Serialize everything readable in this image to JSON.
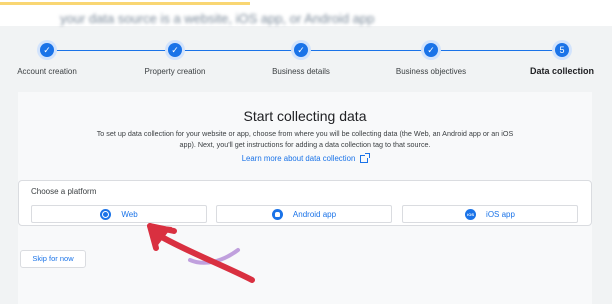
{
  "top_banner": {
    "blurred_text": "your data source is a website, iOS app, or Android app"
  },
  "stepper": {
    "steps": [
      {
        "label": "Account creation",
        "state": "done"
      },
      {
        "label": "Property creation",
        "state": "done"
      },
      {
        "label": "Business details",
        "state": "done"
      },
      {
        "label": "Business objectives",
        "state": "done"
      },
      {
        "label": "Data collection",
        "state": "current",
        "number": "5"
      }
    ],
    "check_glyph": "✓"
  },
  "main": {
    "title": "Start collecting data",
    "description": "To set up data collection for your website or app, choose from where you will be collecting data (the Web, an Android app or an iOS app). Next, you'll get instructions for adding a data collection tag to that source.",
    "learn_more": "Learn more about data collection",
    "platform": {
      "label": "Choose a platform",
      "options": [
        {
          "label": "Web",
          "icon": "globe-icon"
        },
        {
          "label": "Android app",
          "icon": "android-icon"
        },
        {
          "label": "iOS app",
          "icon": "ios-icon"
        }
      ]
    },
    "skip_button": "Skip for now"
  },
  "colors": {
    "accent": "#1a73e8",
    "annotation_arrow": "#d93040"
  }
}
